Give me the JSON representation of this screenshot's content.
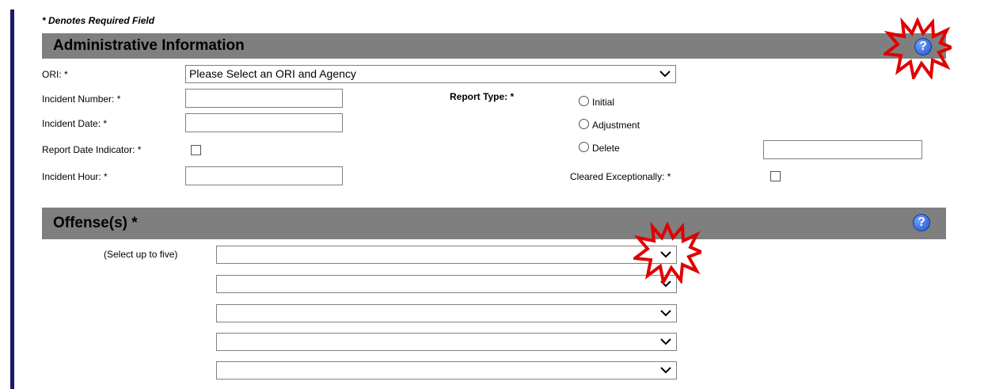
{
  "form": {
    "required_note": "* Denotes Required Field",
    "sections": {
      "admin": {
        "title": "Administrative Information",
        "help_icon_text": "?"
      },
      "offenses": {
        "title": "Offense(s) *",
        "help_icon_text": "?",
        "select_hint": "(Select up to five)",
        "offense_selects": [
          "",
          "",
          "",
          "",
          ""
        ]
      }
    },
    "fields": {
      "ori": {
        "label": "ORI: *",
        "selected": "Please Select an ORI and Agency"
      },
      "incident_number": {
        "label": "Incident Number: *",
        "value": ""
      },
      "incident_date": {
        "label": "Incident Date: *",
        "value": ""
      },
      "report_date_indicator": {
        "label": "Report Date Indicator: *",
        "checked": false
      },
      "incident_hour": {
        "label": "Incident Hour: *",
        "value": ""
      },
      "report_type": {
        "label": "Report Type: *",
        "options": [
          "Initial",
          "Adjustment",
          "Delete"
        ],
        "selected": null
      },
      "delete_reason": {
        "value": ""
      },
      "cleared_exceptionally": {
        "label": "Cleared Exceptionally: *",
        "checked": false
      }
    }
  },
  "colors": {
    "section_bar": "#7f7f7f",
    "left_rule": "#1a1a6e",
    "help_icon": "#2f5fd0",
    "annotation_burst": "#e00000"
  },
  "icons": [
    "help-icon",
    "chevron-down-icon",
    "radio-button",
    "checkbox",
    "annotation-burst"
  ]
}
